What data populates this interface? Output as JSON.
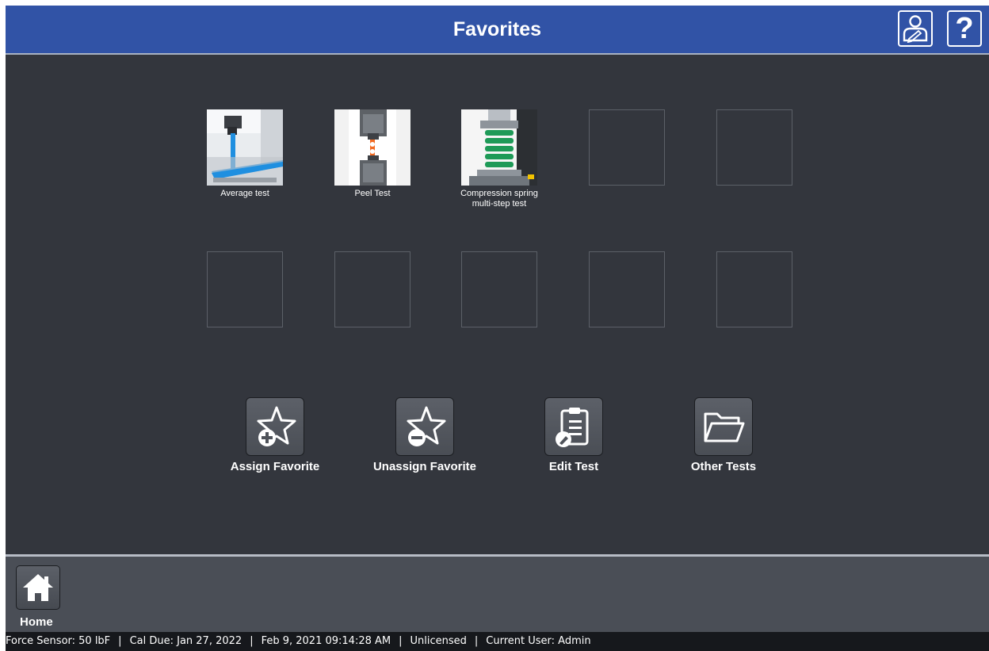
{
  "header": {
    "title": "Favorites",
    "user_icon": "user-edit-icon",
    "help_icon": "help-icon",
    "help_glyph": "?"
  },
  "favorites": [
    {
      "label": "Average test",
      "thumbnail": "tensile-tester-blue-strip"
    },
    {
      "label": "Peel Test",
      "thumbnail": "grips-orange-sample"
    },
    {
      "label": "Compression spring\nmulti-step test",
      "thumbnail": "green-spring"
    },
    {
      "label": "",
      "thumbnail": ""
    },
    {
      "label": "",
      "thumbnail": ""
    },
    {
      "label": "",
      "thumbnail": ""
    },
    {
      "label": "",
      "thumbnail": ""
    },
    {
      "label": "",
      "thumbnail": ""
    },
    {
      "label": "",
      "thumbnail": ""
    },
    {
      "label": "",
      "thumbnail": ""
    }
  ],
  "actions": {
    "assign": {
      "label": "Assign Favorite",
      "icon": "star-plus-icon"
    },
    "unassign": {
      "label": "Unassign Favorite",
      "icon": "star-minus-icon"
    },
    "edit": {
      "label": "Edit Test",
      "icon": "clipboard-edit-icon"
    },
    "other": {
      "label": "Other Tests",
      "icon": "folder-open-icon"
    }
  },
  "footer": {
    "home_label": "Home",
    "home_icon": "home-icon"
  },
  "status": {
    "sensor": "Force Sensor: 50 lbF",
    "cal_due": "Cal Due: Jan 27, 2022",
    "datetime": "Feb 9, 2021 09:14:28 AM",
    "license": "Unlicensed",
    "user": "Current User: Admin",
    "separator": "|"
  },
  "colors": {
    "title_bar": "#3153a6",
    "background": "#33363d",
    "bottom_bar": "#4a4e56",
    "status_bar": "#16181c"
  }
}
